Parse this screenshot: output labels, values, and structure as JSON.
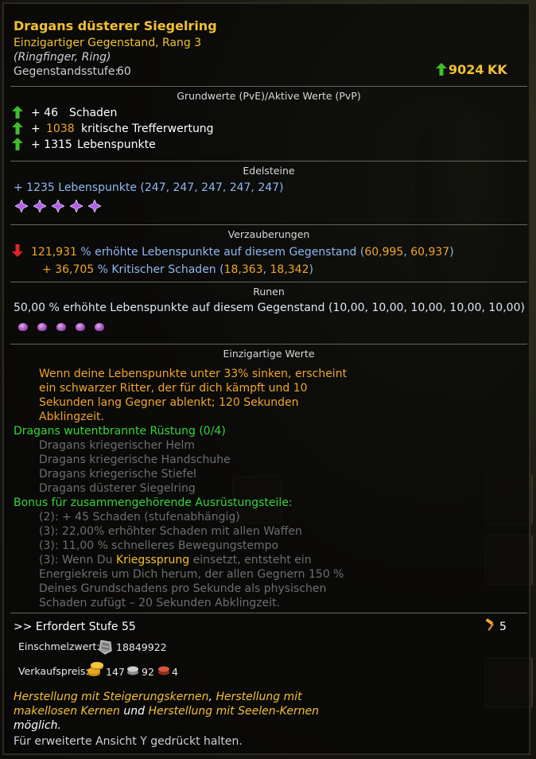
{
  "item": {
    "name": "Dragans düsterer Siegelring",
    "quality": "Einzigartiger Gegenstand, Rang 3",
    "slot": "(Ringfinger, Ring)",
    "level_label": "Gegenstandsstufe:",
    "level_value": "60",
    "power": "9024",
    "power_unit": "KK"
  },
  "base": {
    "header": "Grundwerte (PvE)/Aktive Werte (PvP)",
    "stats": [
      {
        "prefix": "+ 46",
        "text": "Schaden"
      },
      {
        "prefix": "+",
        "value": "1038",
        "text": "kritische Trefferwertung"
      },
      {
        "prefix": "+ 1315",
        "text": "Lebenspunkte"
      }
    ]
  },
  "gems": {
    "header": "Edelsteine",
    "line": "+ 1235 Lebenspunkte (247, 247, 247, 247, 247)",
    "icon": "purple-gem-icon",
    "count": 5
  },
  "enchant": {
    "header": "Verzauberungen",
    "line1_value": "121,931",
    "line1_text": "% erhöhte Lebenspunkte auf diesem Gegenstand (",
    "line1_a": "60,995",
    "line1_sep": ",",
    "line1_b": "60,937",
    "line1_close": ")",
    "line2_value": "+ 36,705",
    "line2_text": "% Kritischer Schaden (",
    "line2_a": "18,363",
    "line2_sep": ",",
    "line2_b": "18,342",
    "line2_close": ")"
  },
  "runes": {
    "header": "Runen",
    "line": "50,00 % erhöhte Lebenspunkte auf diesem Gegenstand (10,00, 10,00, 10,00, 10,00, 10,00)",
    "icon": "pink-rune-icon",
    "count": 5
  },
  "unique": {
    "header": "Einzigartige Werte",
    "desc": [
      "Wenn deine Lebenspunkte unter 33% sinken, erscheint",
      "ein schwarzer Ritter, der für dich kämpft und 10",
      "Sekunden lang Gegner ablenkt; 120 Sekunden",
      "Abklingzeit."
    ],
    "set_name": "Dragans wutentbrannte Rüstung (0/4)",
    "set_items": [
      "Dragans kriegerischer Helm",
      "Dragans kriegerische Handschuhe",
      "Dragans kriegerische Stiefel",
      "Dragans düsterer Siegelring"
    ],
    "bonus_header": "Bonus für zusammengehörende Ausrüstungsteile:",
    "bonus": [
      "(2): + 45 Schaden (stufenabhängig)",
      "(3): 22,00% erhöhter Schaden mit allen Waffen",
      "(3): 11,00 % schnelleres Bewegungstempo"
    ],
    "bonus4_pre": "(3): Wenn Du",
    "bonus4_skill": "Kriegssprung",
    "bonus4_post": "einsetzt, entsteht ein",
    "bonus4_rest": [
      "Energiekreis um Dich herum, der allen Gegnern 150 %",
      "Deines Grundschadens pro Sekunde als physischen",
      "Schaden zufügt – 20 Sekunden Abklingzeit."
    ]
  },
  "footer": {
    "requires": ">> Erfordert Stufe 55",
    "upgrade_count": "5",
    "melt_label": "Einschmelzwert:",
    "melt_value": "18849922",
    "sell_label": "Verkaufspreis:",
    "gold": "147",
    "silver": "92",
    "copper": "4",
    "craft1_a": "Herstellung mit Steigerungskernen",
    "craft1_b": ",",
    "craft1_c": "Herstellung mit",
    "craft2_a": "makellosen Kernen",
    "craft2_b": "und",
    "craft2_c": "Herstellung mit Seelen-Kernen",
    "craft3": "möglich.",
    "hint": "Für erweiterte Ansicht Y gedrückt halten."
  },
  "colors": {
    "title": "#f2c131",
    "orange": "#f0a52b",
    "blue": "#8fb8ef",
    "set_green": "#35d53b",
    "up_arrow": "#3fbf2c",
    "down_arrow": "#e02424"
  }
}
